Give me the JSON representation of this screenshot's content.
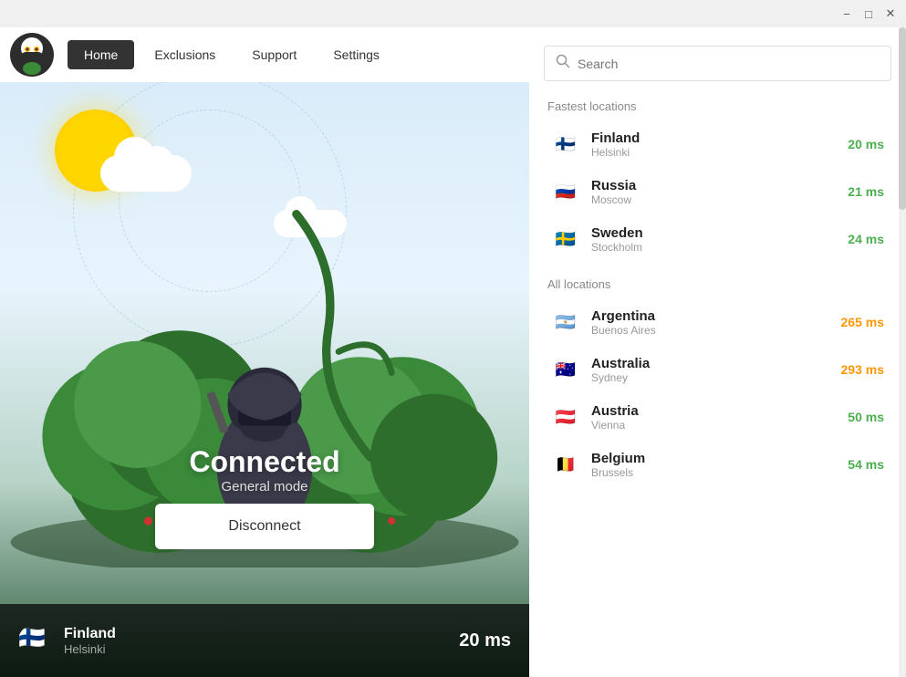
{
  "window": {
    "minimize_label": "−",
    "maximize_label": "□",
    "close_label": "✕"
  },
  "nav": {
    "home_label": "Home",
    "exclusions_label": "Exclusions",
    "support_label": "Support",
    "settings_label": "Settings"
  },
  "hero": {
    "status": "Connected",
    "mode": "General mode",
    "disconnect_label": "Disconnect"
  },
  "status_bar": {
    "country": "Finland",
    "city": "Helsinki",
    "ping": "20 ms",
    "flag": "🇫🇮"
  },
  "search": {
    "placeholder": "Search"
  },
  "fastest_locations": {
    "label": "Fastest locations",
    "items": [
      {
        "country": "Finland",
        "city": "Helsinki",
        "ping": "20 ms",
        "ping_class": "ping-fast",
        "flag": "🇫🇮"
      },
      {
        "country": "Russia",
        "city": "Moscow",
        "ping": "21 ms",
        "ping_class": "ping-fast",
        "flag": "🇷🇺"
      },
      {
        "country": "Sweden",
        "city": "Stockholm",
        "ping": "24 ms",
        "ping_class": "ping-fast",
        "flag": "🇸🇪"
      }
    ]
  },
  "all_locations": {
    "label": "All locations",
    "items": [
      {
        "country": "Argentina",
        "city": "Buenos Aires",
        "ping": "265 ms",
        "ping_class": "ping-medium",
        "flag": "🇦🇷"
      },
      {
        "country": "Australia",
        "city": "Sydney",
        "ping": "293 ms",
        "ping_class": "ping-medium",
        "flag": "🇦🇺"
      },
      {
        "country": "Austria",
        "city": "Vienna",
        "ping": "50 ms",
        "ping_class": "ping-fast",
        "flag": "🇦🇹"
      },
      {
        "country": "Belgium",
        "city": "Brussels",
        "ping": "54 ms",
        "ping_class": "ping-fast",
        "flag": "🇧🇪"
      }
    ]
  }
}
